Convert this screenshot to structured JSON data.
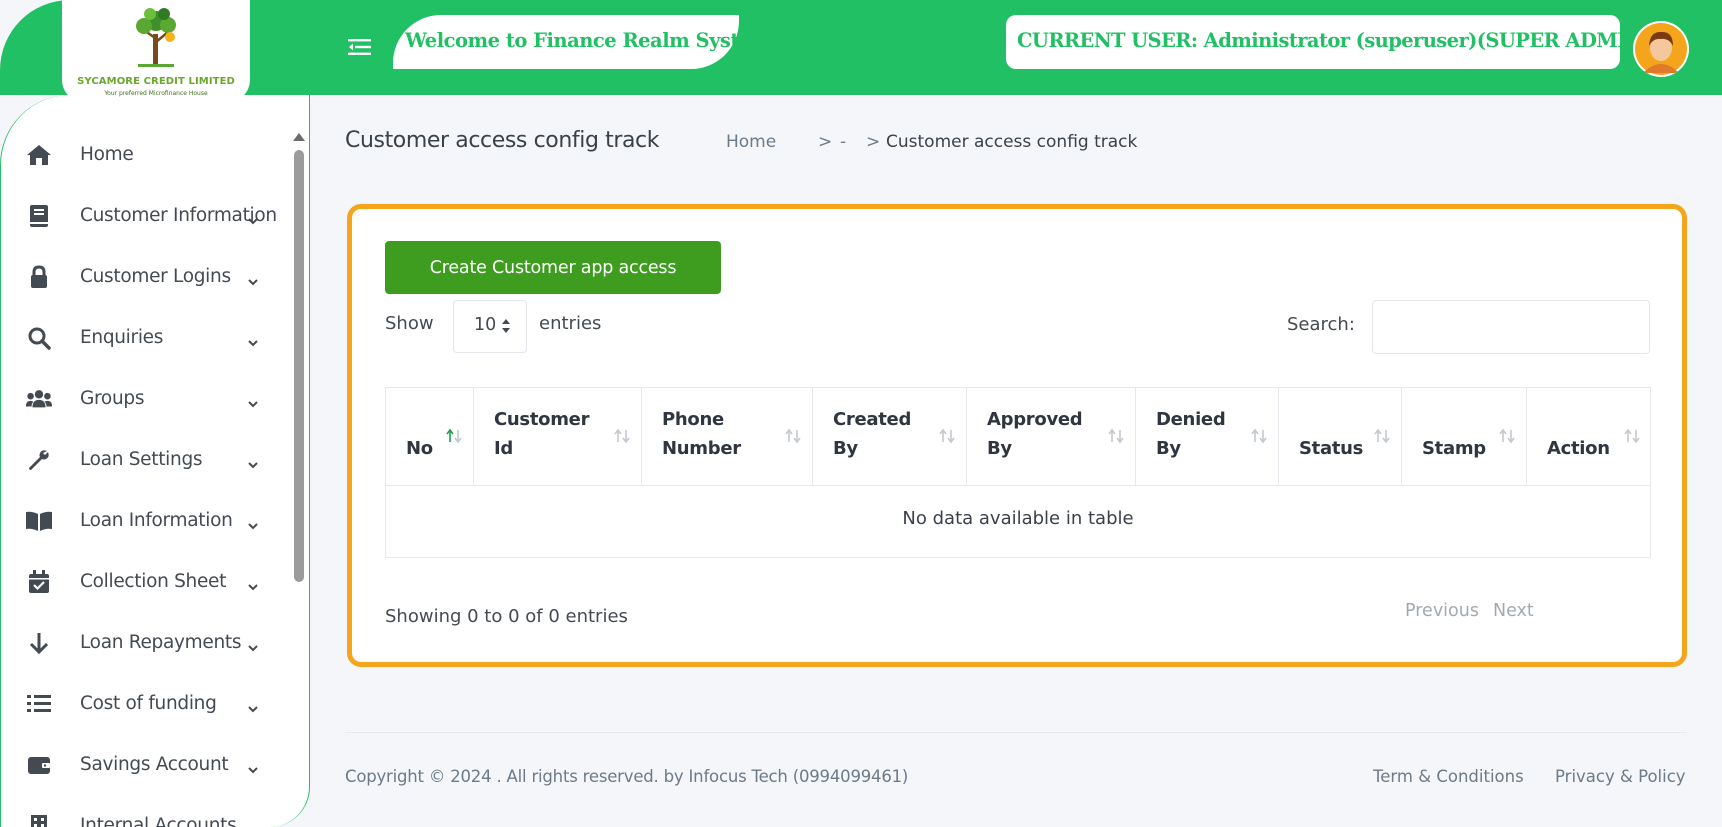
{
  "colors": {
    "brand_green": "#22c064",
    "button_green": "#3e9d1f",
    "card_border": "#f5a51b",
    "page_bg": "#f4f6f9"
  },
  "logo": {
    "company": "SYCAMORE CREDIT LIMITED",
    "tagline": "Your preferred Microfinance House",
    "icon": "tree-logo"
  },
  "header": {
    "menu_icon": "hamburger-icon",
    "welcome": "Welcome to Finance Realm System",
    "current_user": "CURRENT USER: Administrator (superuser)(SUPER ADMIN)",
    "avatar_icon": "user-avatar"
  },
  "sidebar": {
    "items": [
      {
        "label": "Home",
        "icon": "home-icon",
        "expandable": false
      },
      {
        "label": "Customer Information",
        "icon": "book-icon",
        "expandable": true
      },
      {
        "label": "Customer Logins",
        "icon": "lock-icon",
        "expandable": true
      },
      {
        "label": "Enquiries",
        "icon": "search-icon",
        "expandable": true
      },
      {
        "label": "Groups",
        "icon": "users-icon",
        "expandable": true
      },
      {
        "label": "Loan Settings",
        "icon": "wrench-icon",
        "expandable": true
      },
      {
        "label": "Loan Information",
        "icon": "open-book-icon",
        "expandable": true
      },
      {
        "label": "Collection Sheet",
        "icon": "calendar-check-icon",
        "expandable": true
      },
      {
        "label": "Loan Repayments",
        "icon": "arrow-down-icon",
        "expandable": true
      },
      {
        "label": "Cost of funding",
        "icon": "list-icon",
        "expandable": true
      },
      {
        "label": "Savings Account",
        "icon": "wallet-icon",
        "expandable": true
      },
      {
        "label": "Internal Accounts",
        "icon": "building-icon",
        "expandable": true
      }
    ]
  },
  "page": {
    "title": "Customer access config track",
    "breadcrumb": {
      "home": "Home",
      "separator": ">",
      "middle": "-",
      "current": "Customer access config track"
    }
  },
  "card": {
    "create_button": "Create Customer app access",
    "show_label": "Show",
    "entries_value": "10",
    "entries_label": "entries",
    "search_label": "Search:",
    "search_value": "",
    "table": {
      "columns": [
        [
          "No"
        ],
        [
          "Customer",
          "Id"
        ],
        [
          "Phone",
          "Number"
        ],
        [
          "Created",
          "By"
        ],
        [
          "Approved",
          "By"
        ],
        [
          "Denied",
          "By"
        ],
        [
          "Status"
        ],
        [
          "Stamp"
        ],
        [
          "Action"
        ]
      ],
      "sorted_column": "No",
      "sort_direction": "ascending",
      "empty_message": "No data available in table"
    },
    "info": "Showing 0 to 0 of 0 entries",
    "pagination": {
      "previous": "Previous",
      "next": "Next"
    }
  },
  "footer": {
    "copyright": "Copyright © 2024 . All rights reserved. by Infocus Tech (0994099461)",
    "terms": "Term & Conditions",
    "privacy": "Privacy & Policy"
  }
}
